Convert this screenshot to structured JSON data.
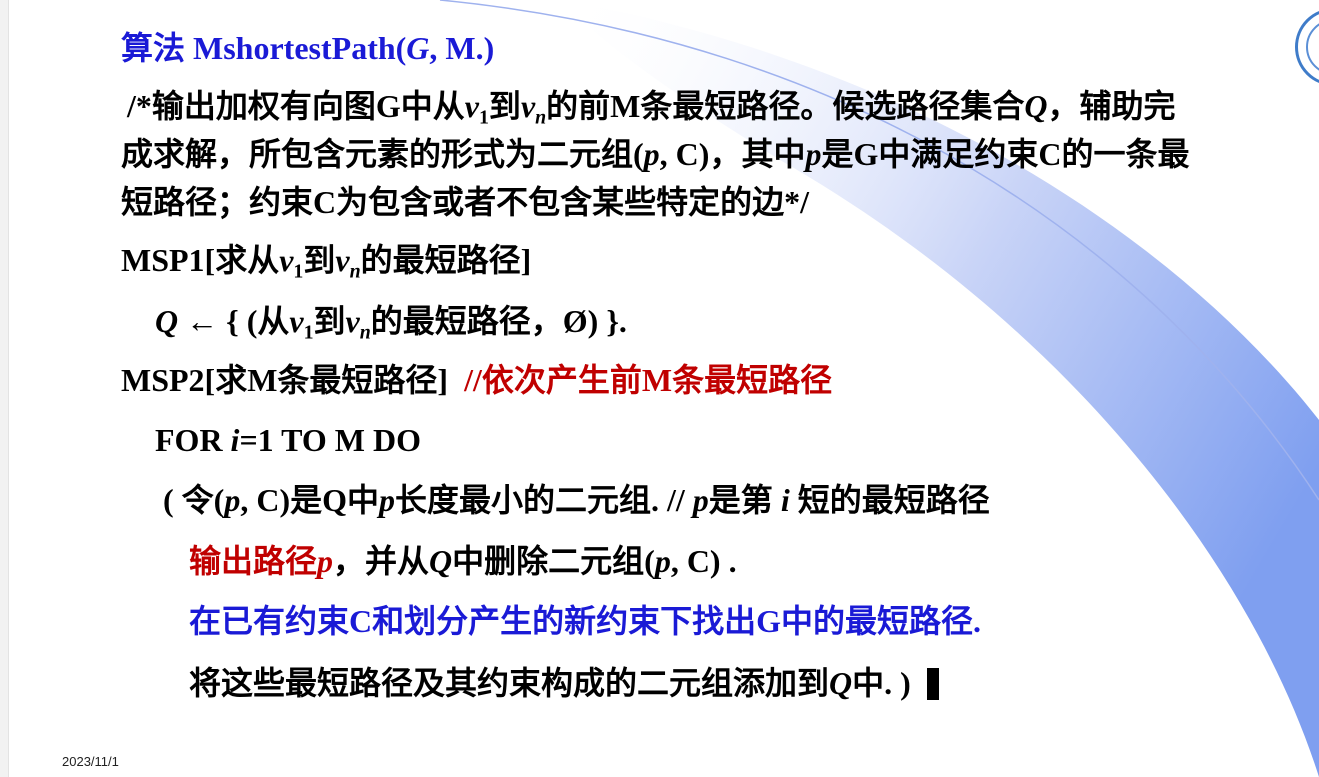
{
  "slide": {
    "title_cn": "算法",
    "title_name": "MshortestPath(",
    "title_g": "G",
    "title_rest": ", M.)",
    "comment": {
      "l1_a": "/*输出加权有向图G中从",
      "v": "v",
      "sub1": "1",
      "dao": "到",
      "subn": "n",
      "l1_b": "的前M条最短路径。候选路径集合",
      "q": "Q",
      "l1_c": "，辅助完",
      "l2_a": "成求解，所包含元素的形式为二元组(",
      "p": "p",
      "l2_b": ", C)，其中",
      "l2_c": "是G中满足约束C的一条最",
      "l3": "短路径；约束C为包含或者不包含某些特定的边*/"
    },
    "msp1": {
      "head_a": "MSP1[求从",
      "head_b": "的最短路径]",
      "q": "Q",
      "assign_a": " ← { (从",
      "assign_b": "的最短路径，Ø) }."
    },
    "msp2": {
      "head": "MSP2[求M条最短路径]",
      "head_comment": "//依次产生前M条最短路径",
      "for_a": "FOR ",
      "i": "i",
      "for_b": "=1 TO M DO",
      "s1_a": "( 令(",
      "s1_b": ", C)是Q中",
      "s1_c": "长度最小的二元组.  // ",
      "s1_d": "是第 ",
      "s1_e": " 短的最短路径",
      "s2_red": "输出路径",
      "s2_a": "，并从",
      "s2_b": "中删除二元组(",
      "s2_c": ", C) .",
      "s3": "在已有约束C和划分产生的新约束下找出G中的最短路径.",
      "s4_a": "将这些最短路径及其约束构成的二元组添加到",
      "s4_b": "中.  )"
    },
    "date": "2023/11/1"
  },
  "colors": {
    "title_blue": "#1a1ad6",
    "comment_red": "#c00000",
    "accent_blue": "#8fa8f0"
  },
  "icons": {
    "seal": "university-seal-icon",
    "end": "end-of-algorithm-icon"
  }
}
